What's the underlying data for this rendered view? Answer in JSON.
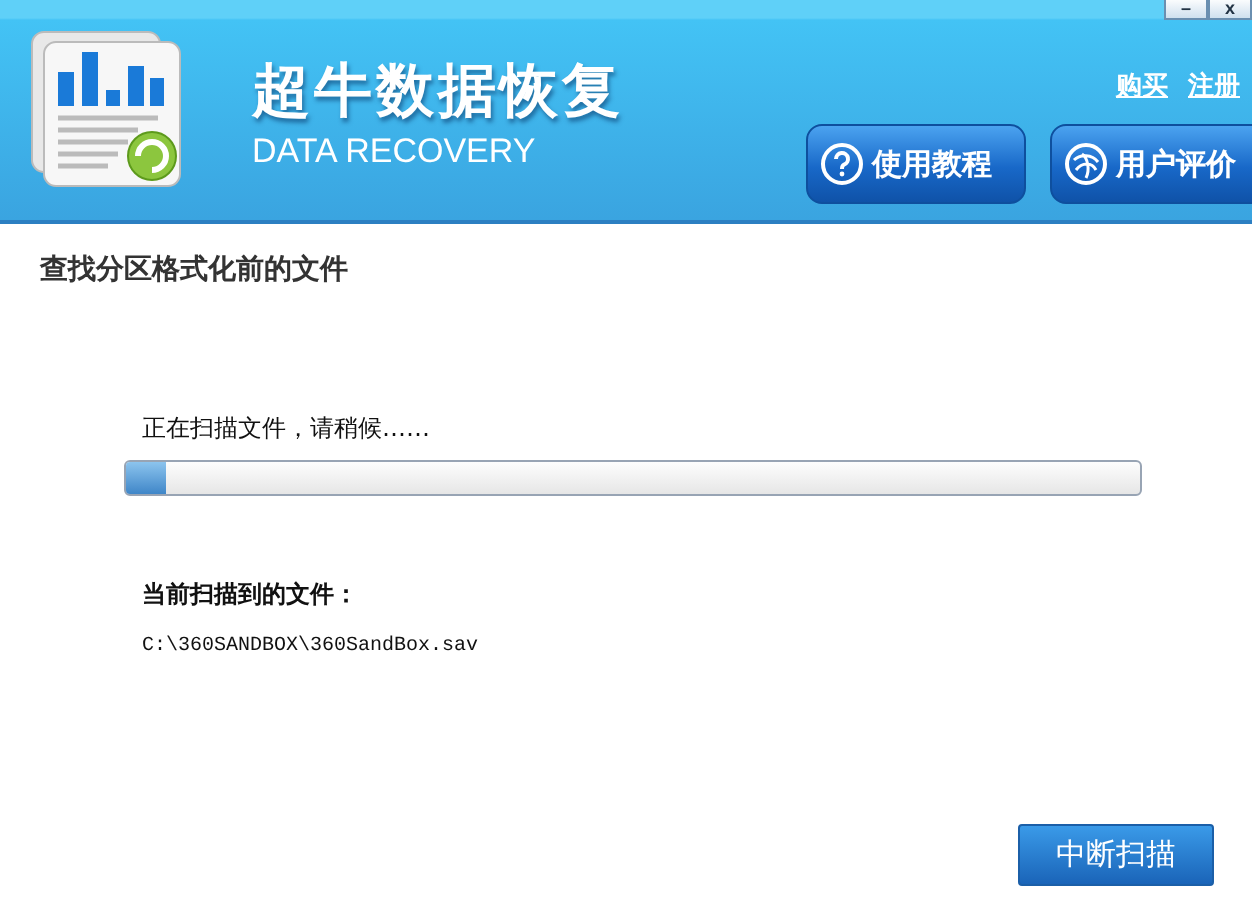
{
  "window_controls": [
    "–",
    "x"
  ],
  "header": {
    "title": "超牛数据恢复",
    "subtitle": "DATA RECOVERY",
    "links": [
      "购买",
      "注册"
    ],
    "buttons": [
      {
        "label": "使用教程",
        "kind": "help"
      },
      {
        "label": "用户评价",
        "kind": "review"
      }
    ]
  },
  "heading": "查找分区格式化前的文件",
  "status": "正在扫描文件，请稍候……",
  "progress": {
    "level": 0.04
  },
  "current_label": "当前扫描到的文件：",
  "current_file": "C:\\360SANDBOX\\360SandBox.sav",
  "stop_button": "中断扫描"
}
